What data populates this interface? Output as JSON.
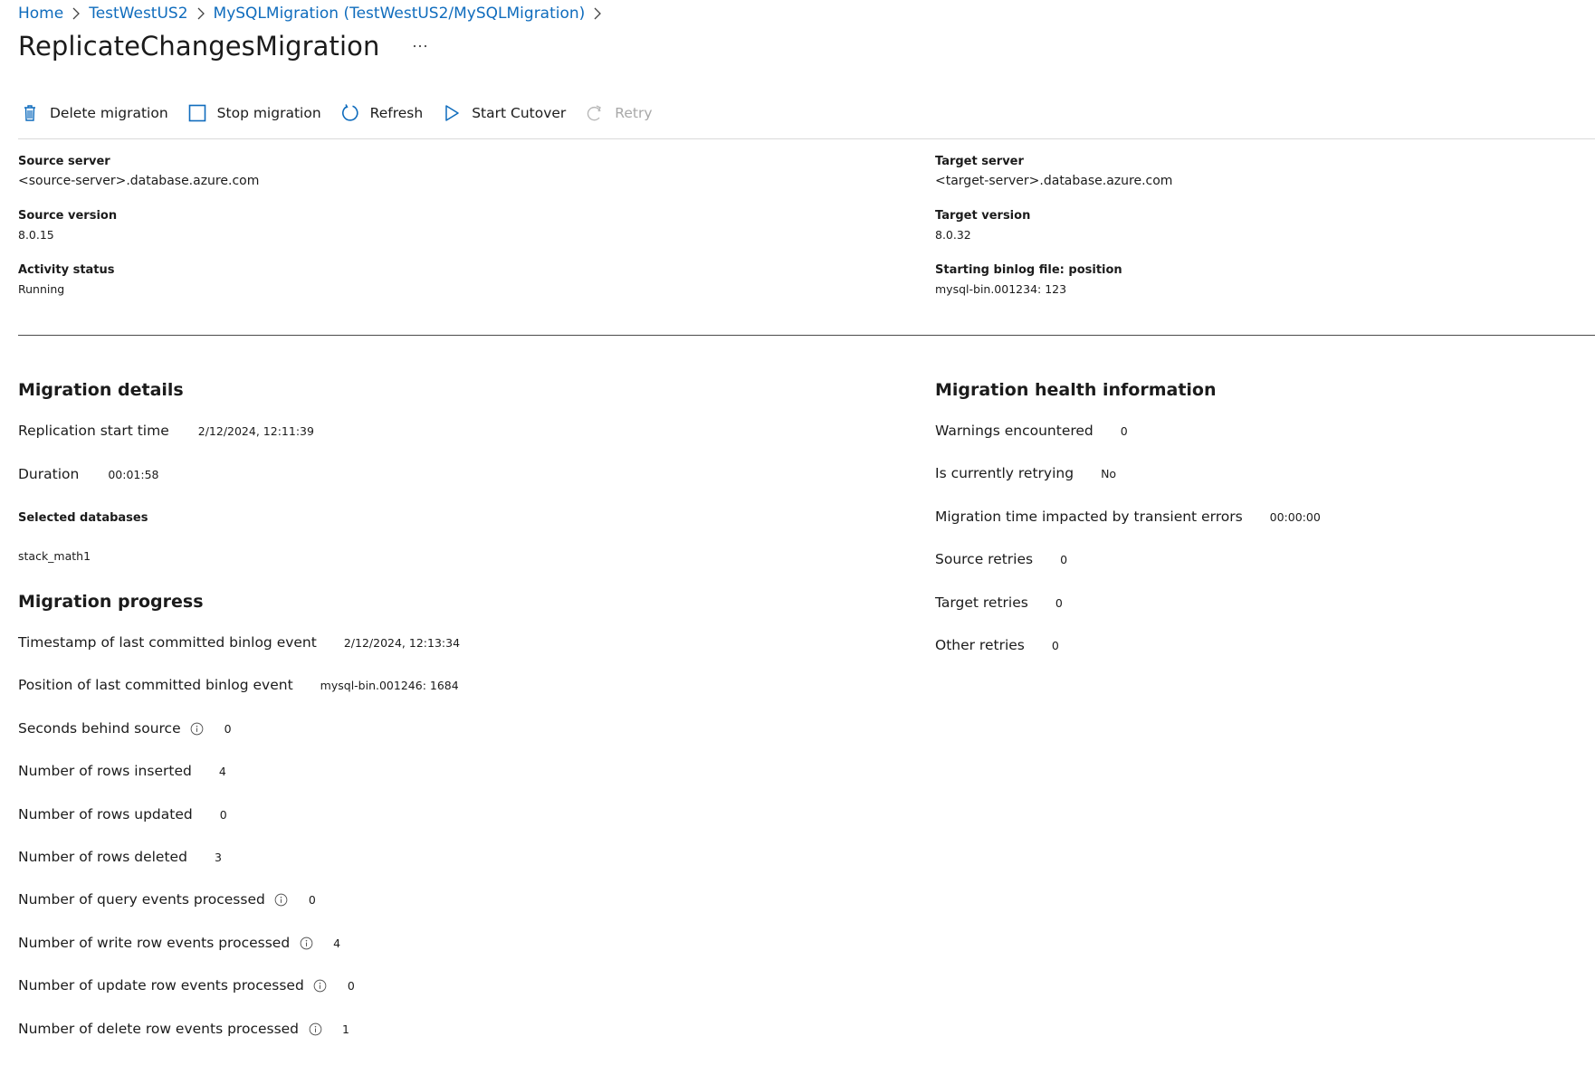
{
  "breadcrumb": {
    "items": [
      "Home",
      "TestWestUS2",
      "MySQLMigration (TestWestUS2/MySQLMigration)"
    ]
  },
  "page": {
    "title": "ReplicateChangesMigration",
    "more_label": "..."
  },
  "toolbar": {
    "delete_label": "Delete migration",
    "stop_label": "Stop migration",
    "refresh_label": "Refresh",
    "cutover_label": "Start Cutover",
    "retry_label": "Retry",
    "accent_color": "#0f6cbd",
    "disabled_color": "#a8a8a8"
  },
  "essentials": {
    "source_server_label": "Source server",
    "source_server_value": "<source-server>.database.azure.com",
    "source_version_label": "Source version",
    "source_version_value": "8.0.15",
    "activity_status_label": "Activity status",
    "activity_status_value": "Running",
    "target_server_label": "Target server",
    "target_server_value": "<target-server>.database.azure.com",
    "target_version_label": "Target version",
    "target_version_value": "8.0.32",
    "binlog_label": "Starting binlog file: position",
    "binlog_value": "mysql-bin.001234: 123"
  },
  "details": {
    "heading": "Migration details",
    "replication_start_label": "Replication start time",
    "replication_start_value": "2/12/2024, 12:11:39",
    "duration_label": "Duration",
    "duration_value": "00:01:58",
    "selected_db_label": "Selected databases",
    "selected_db_value": "stack_math1"
  },
  "progress": {
    "heading": "Migration progress",
    "items": [
      {
        "label": "Timestamp of last committed binlog event",
        "value": "2/12/2024, 12:13:34",
        "info": false
      },
      {
        "label": "Position of last committed binlog event",
        "value": "mysql-bin.001246: 1684",
        "info": false
      },
      {
        "label": "Seconds behind source",
        "value": "0",
        "info": true
      },
      {
        "label": "Number of rows inserted",
        "value": "4",
        "info": false
      },
      {
        "label": "Number of rows updated",
        "value": "0",
        "info": false
      },
      {
        "label": "Number of rows deleted",
        "value": "3",
        "info": false
      },
      {
        "label": "Number of query events processed",
        "value": "0",
        "info": true
      },
      {
        "label": "Number of write row events processed",
        "value": "4",
        "info": true
      },
      {
        "label": "Number of update row events processed",
        "value": "0",
        "info": true
      },
      {
        "label": "Number of delete row events processed",
        "value": "1",
        "info": true
      }
    ]
  },
  "health": {
    "heading": "Migration health information",
    "items": [
      {
        "label": "Warnings encountered",
        "value": "0"
      },
      {
        "label": "Is currently retrying",
        "value": "No"
      },
      {
        "label": "Migration time impacted by transient errors",
        "value": "00:00:00"
      },
      {
        "label": "Source retries",
        "value": "0"
      },
      {
        "label": "Target retries",
        "value": "0"
      },
      {
        "label": "Other retries",
        "value": "0"
      }
    ]
  }
}
